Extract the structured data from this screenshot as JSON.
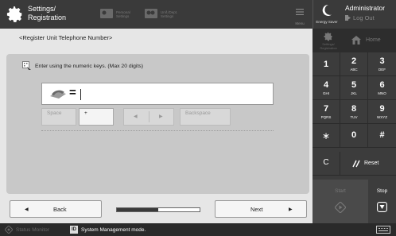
{
  "header": {
    "title_line1": "Settings/",
    "title_line2": "Registration",
    "personal_settings_line1": "Personal",
    "personal_settings_line2": "Settings",
    "unified_settings_line1": "Unif./Dept.",
    "unified_settings_line2": "Settings",
    "menu_label": "Menu",
    "energy_saver_label": "Energy Saver",
    "user_label": "Administrator",
    "logout_label": "Log Out"
  },
  "main": {
    "page_title": "<Register Unit Telephone Number>",
    "instruction": "Enter using the numeric keys. (Max 20 digits)",
    "entry_prefix": "=",
    "entry_value": "",
    "keys": {
      "space": "Space",
      "plus": "+",
      "left": "◀",
      "right": "▶",
      "backspace": "Backspace"
    }
  },
  "nav": {
    "back_label": "Back",
    "back_arrow": "◀",
    "next_label": "Next",
    "next_arrow": "▶",
    "progress": 0.5
  },
  "side": {
    "settings_line1": "Settings/",
    "settings_line2": "Registration",
    "home_label": "Home",
    "keypad": [
      {
        "num": "1",
        "sub": ""
      },
      {
        "num": "2",
        "sub": "ABC"
      },
      {
        "num": "3",
        "sub": "DEF"
      },
      {
        "num": "4",
        "sub": "GHI"
      },
      {
        "num": "5",
        "sub": "JKL"
      },
      {
        "num": "6",
        "sub": "MNO"
      },
      {
        "num": "7",
        "sub": "PQRS"
      },
      {
        "num": "8",
        "sub": "TUV"
      },
      {
        "num": "9",
        "sub": "WXYZ"
      }
    ],
    "star": "∗",
    "zero": "0",
    "hash": "#",
    "clear": "C",
    "reset": "Reset",
    "start": "Start",
    "stop": "Stop"
  },
  "status": {
    "monitor_label": "Status Monitor",
    "id_badge": "ID",
    "message": "System Management mode."
  },
  "colors": {
    "header_bg": "#3a3a3a",
    "keypad_bg": "#3c3c3c",
    "panel_bg": "#c8c8c8"
  }
}
